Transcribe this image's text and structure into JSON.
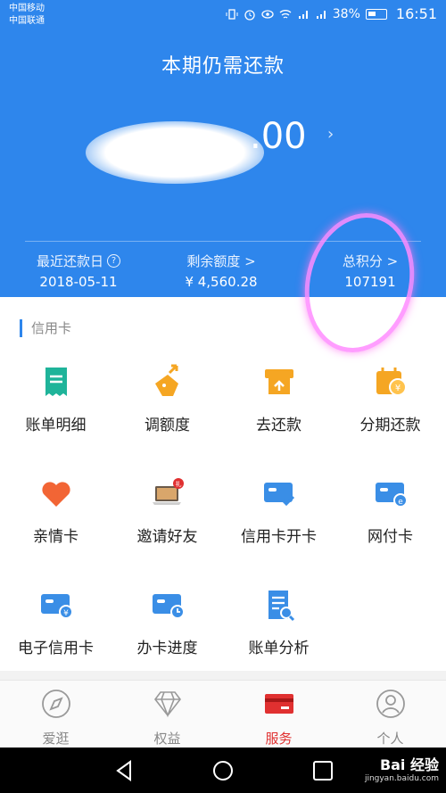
{
  "status_bar": {
    "carrier_1": "中国移动",
    "carrier_2": "中国联通",
    "battery": "38%",
    "time": "16:51"
  },
  "hero": {
    "title": "本期仍需还款",
    "amount_visible": ".00",
    "stats": [
      {
        "label": "最近还款日",
        "value": "2018-05-11"
      },
      {
        "label": "剩余额度 >",
        "value": "¥ 4,560.28"
      },
      {
        "label": "总积分 >",
        "value": "107191"
      }
    ]
  },
  "section": {
    "label": "信用卡"
  },
  "services": [
    {
      "label": "账单明细",
      "icon": "bill-detail-icon"
    },
    {
      "label": "调额度",
      "icon": "adjust-limit-icon"
    },
    {
      "label": "去还款",
      "icon": "repay-icon"
    },
    {
      "label": "分期还款",
      "icon": "installment-icon"
    },
    {
      "label": "亲情卡",
      "icon": "heart-icon"
    },
    {
      "label": "邀请好友",
      "icon": "invite-laptop-icon"
    },
    {
      "label": "信用卡开卡",
      "icon": "card-activate-icon"
    },
    {
      "label": "网付卡",
      "icon": "web-pay-card-icon"
    },
    {
      "label": "电子信用卡",
      "icon": "e-card-icon"
    },
    {
      "label": "办卡进度",
      "icon": "card-progress-icon"
    },
    {
      "label": "账单分析",
      "icon": "bill-analysis-icon"
    }
  ],
  "tabs": [
    {
      "label": "爱逛",
      "icon": "compass-icon"
    },
    {
      "label": "权益",
      "icon": "diamond-icon"
    },
    {
      "label": "服务",
      "icon": "card-service-icon",
      "active": true
    },
    {
      "label": "个人",
      "icon": "person-icon"
    }
  ],
  "watermark": {
    "brand": "Bai 经验",
    "url": "jingyan.baidu.com"
  },
  "colors": {
    "primary_blue": "#2e86ec",
    "accent_red": "#e03030",
    "orange": "#f5a623",
    "teal": "#1fb49a"
  }
}
